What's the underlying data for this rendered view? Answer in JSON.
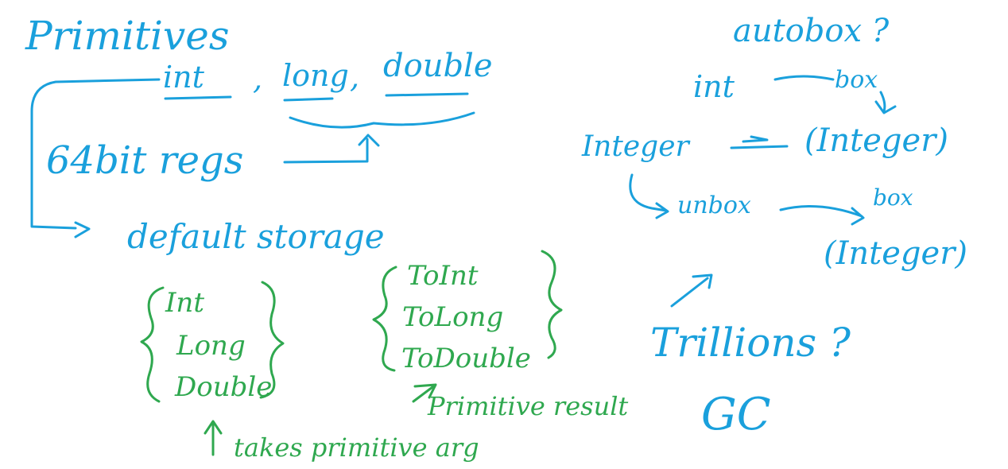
{
  "colors": {
    "blue_ink": "#1aa0dc",
    "green_ink": "#2fa84f",
    "background": "#ffffff"
  },
  "notes": {
    "primitives": "Primitives",
    "int": "int",
    "comma1": ",",
    "long": "long",
    "comma2": ",",
    "double": "double",
    "bits": "64bit regs",
    "default_storage": "default storage",
    "green_box1": [
      "Int",
      "Long",
      "Double"
    ],
    "green_box2": [
      "ToInt",
      "ToLong",
      "ToDouble"
    ],
    "primitive_result": "Primitive result",
    "takes_primitive_arg": "takes primitive arg",
    "autobox": "autobox ?",
    "int_right": "int",
    "box_top": "box",
    "integer_paren1": "(Integer)",
    "integer_left": "Integer",
    "unbox": "unbox",
    "box_mid": "box",
    "integer_paren2": "(Integer)",
    "trillions": "Trillions ?",
    "gc": "GC"
  }
}
